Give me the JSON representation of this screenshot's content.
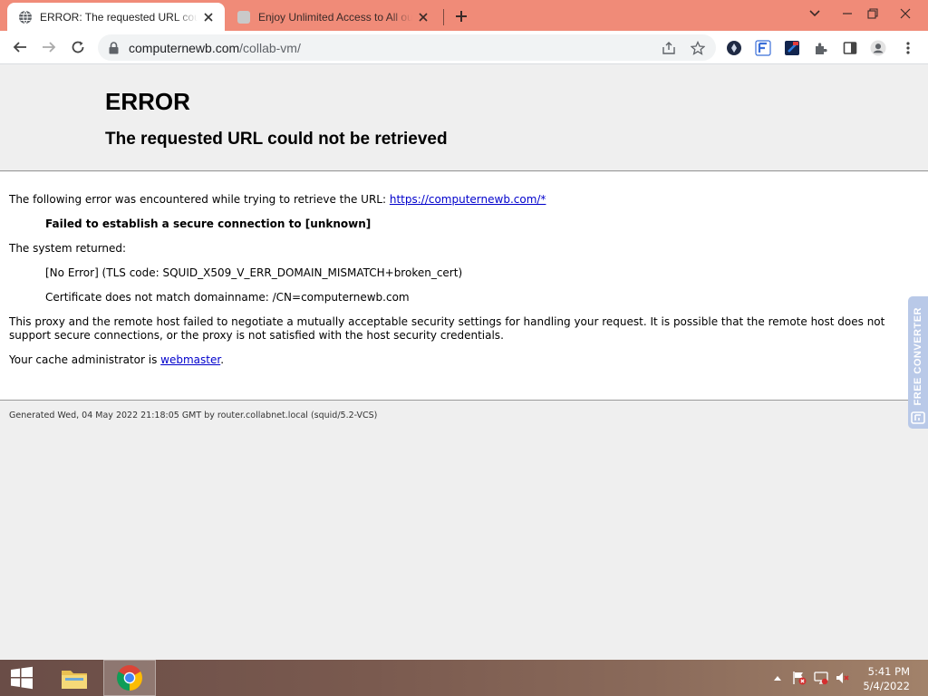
{
  "browser": {
    "tabs": [
      {
        "title": "ERROR: The requested URL could not be retrieved",
        "active": true
      },
      {
        "title": "Enjoy Unlimited Access to All our",
        "active": false
      }
    ],
    "url_domain": "computernewb.com",
    "url_path": "/collab-vm/",
    "colors": {
      "tabstrip": "#f08b78",
      "toolbar": "#ffffff"
    }
  },
  "page": {
    "heading": "ERROR",
    "subheading": "The requested URL could not be retrieved",
    "intro_text": "The following error was encountered while trying to retrieve the URL: ",
    "intro_link": "https://computernewb.com/*",
    "error_message": "Failed to establish a secure connection to [unknown]",
    "system_returned": "The system returned:",
    "system_detail": "[No Error] (TLS code: SQUID_X509_V_ERR_DOMAIN_MISMATCH+broken_cert)",
    "cert_detail": "Certificate does not match domainname: /CN=computernewb.com",
    "explanation": "This proxy and the remote host failed to negotiate a mutually acceptable security settings for handling your request. It is possible that the remote host does not support secure connections, or the proxy is not satisfied with the host security credentials.",
    "admin_text": "Your cache administrator is ",
    "admin_link": "webmaster",
    "admin_suffix": ".",
    "footer": "Generated Wed, 04 May 2022 21:18:05 GMT by router.collabnet.local (squid/5.2-VCS)"
  },
  "widget": {
    "label": "FREE CONVERTER"
  },
  "taskbar": {
    "time": "5:41 PM",
    "date": "5/4/2022"
  }
}
